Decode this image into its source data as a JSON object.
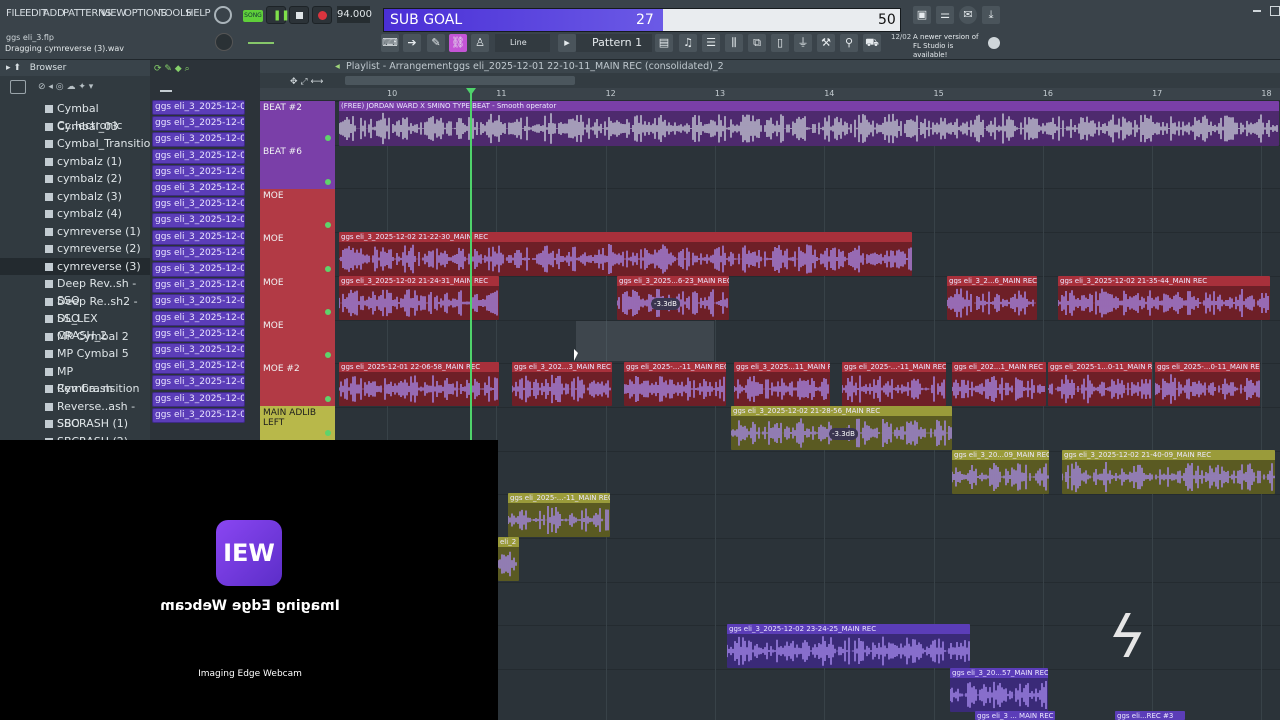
{
  "menu": [
    "FILE",
    "EDIT",
    "ADD",
    "PATTERNS",
    "VIEW",
    "OPTIONS",
    "TOOLS",
    "HELP"
  ],
  "project": {
    "file": "ggs eli_3.flp",
    "hint": "Dragging cymreverse (3).wav"
  },
  "transport": {
    "song_label": "SONG",
    "tempo": "94.000",
    "pattern": "Pattern 1",
    "snap": "Line"
  },
  "sub_goal": {
    "label": "SUB GOAL",
    "current": "27",
    "target": "50",
    "progress": 0.54
  },
  "news": {
    "date": "12/02",
    "text": "A newer version of FL Studio is available!"
  },
  "browser": {
    "title": "Browser",
    "items": [
      "Cymbal Cr..lectronic",
      "Cymbal_03",
      "Cymbal_Transition",
      "cymbalz (1)",
      "cymbalz (2)",
      "cymbalz (3)",
      "cymbalz (4)",
      "cymreverse (1)",
      "cymreverse (2)",
      "cymreverse (3)",
      "Deep Rev..sh - SSO",
      "Deep Re..sh2 - SSO",
      "DL_LEX CRASH_2",
      "MP Cymbal 2",
      "MP Cymbal 5",
      "MP Cymba..nsition",
      "Rev Crash",
      "Reverse..ash - SSO",
      "SBCRASH (1)",
      "SBCRASH (2)"
    ]
  },
  "channels": [
    "ggs eli_3_2025-12-02 21...",
    "ggs eli_3_2025-12-02 21...",
    "ggs eli_3_2025-12-02 21...",
    "ggs eli_3_2025-12-02 21...",
    "ggs eli_3_2025-12-02 21...",
    "ggs eli_3_2025-12-02 21...",
    "ggs eli_3_2025-12-02 21...",
    "ggs eli_3_2025-12-02 21...",
    "ggs eli_3_2025-12-02 21...",
    "ggs eli_3_2025-12-02 21...",
    "ggs eli_3_2025-12-02 21...",
    "ggs eli_3_2025-12-02 21...",
    "ggs eli_3_2025-12-02 22...",
    "ggs eli_3_2025-12-02 22...",
    "ggs eli_3_2025-12-02 22...",
    "ggs eli_3_2025-12-02 22...",
    "ggs eli_3_2025-12-02 22...",
    "ggs eli_3_2025-12-02 22...",
    "ggs eli_3_2025-12-02 22...",
    "ggs eli_3_2025-12-02 22..."
  ],
  "playlist": {
    "title": "Playlist - Arrangement",
    "path": "ggs eli_2025-12-01 22-10-11_MAIN REC (consolidated)_2",
    "bars": [
      "10",
      "11",
      "12",
      "13",
      "14",
      "15",
      "16",
      "17",
      "18"
    ],
    "tracks": [
      "BEAT #2",
      "BEAT #6",
      "MOE",
      "MOE",
      "MOE",
      "MOE",
      "MOE #2",
      "MAIN ADLIB LEFT"
    ]
  },
  "clips": {
    "beat": "(FREE) JORDAN WARD X SMINO TYPE BEAT - Smooth operator",
    "moe_long": "ggs eli_3_2025-12-02 21-22-30_MAIN REC",
    "moe3_a": "ggs eli_3_2025-12-02 21-24-31_MAIN REC",
    "moe3_b": "ggs eli_3_2025...6-23_MAIN REC",
    "moe3_c": "ggs eli_3_2...6_MAIN REC",
    "moe3_d": "ggs eli_3_2025-12-02 21-35-44_MAIN REC",
    "moe2_a": "ggs eli_2025-12-01 22-06-58_MAIN REC",
    "moe2_b": "ggs eli_3_202...3_MAIN REC",
    "moe2_c": "ggs eli_2025-...-11_MAIN REC",
    "moe2_d": "ggs eli_3_2025...11_MAIN REC",
    "moe2_e": "ggs eli_2025-...-11_MAIN REC",
    "moe2_f": "ggs eli_202...1_MAIN REC",
    "moe2_g": "ggs eli_2025-1...0-11_MAIN REC",
    "moe2_h": "ggs eli_2025-...0-11_MAIN REC",
    "adlib_a": "ggs eli_3_2025-12-02 21-28-56_MAIN REC",
    "adlib_b": "ggs eli_3_20...09_MAIN REC",
    "adlib_c": "ggs eli_3_2025-12-02 21-40-09_MAIN REC",
    "small_a": "ggs eli_2025-...-11_MAIN REC",
    "small_b": "eli_2",
    "bottom_a": "ggs eli_3_2025-12-02 23-24-25_MAIN REC",
    "bottom_b": "ggs eli_3_20...57_MAIN REC",
    "bottom_c": "ggs eli_3 ... MAIN REC",
    "bottom_d": "ggs eli...REC #3",
    "gain": "-3.3dB"
  },
  "webcam": {
    "brand_mirrored": "Imaging Edge Webcam",
    "caption": "Imaging Edge Webcam",
    "logo": "IEW"
  },
  "colors": {
    "beat": "#7a3fa8",
    "moe": "#b23a45",
    "adlib": "#b8b84a",
    "wave": "#a98cf0"
  }
}
